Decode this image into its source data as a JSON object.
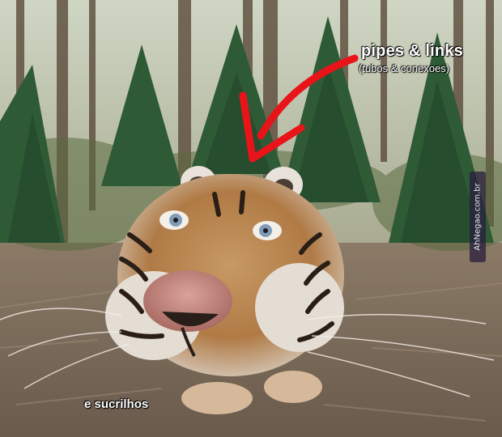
{
  "image": {
    "captions": {
      "title": "pipes & links",
      "subtitle": "(tubos & conexoes)",
      "bottom": "e sucrilhos"
    },
    "watermark": "AhNegao.com.br",
    "colors": {
      "arrow": "#e8141a",
      "caption_text": "#ffffff",
      "ground": "#7a6a5c",
      "foliage": "#2f5a36"
    }
  }
}
